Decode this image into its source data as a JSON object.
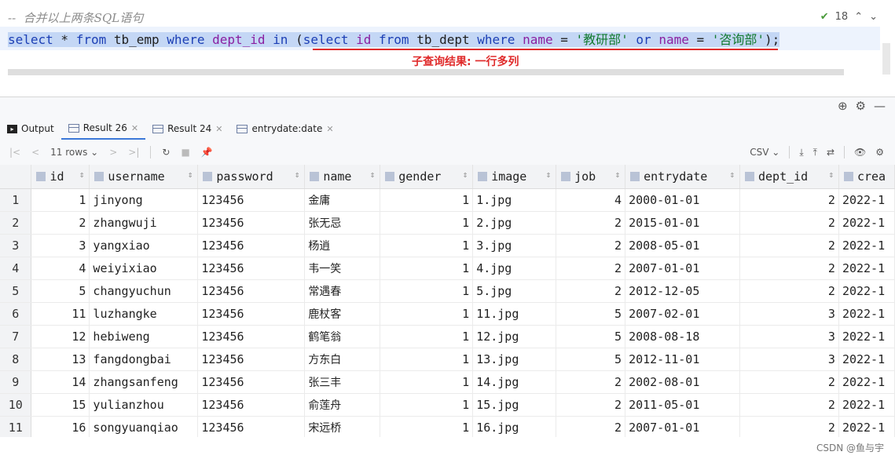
{
  "editor": {
    "comment": "--  合并以上两条SQL语句",
    "inspection_count": "18",
    "sql": {
      "p1": "select",
      "p2": " * ",
      "p3": "from",
      "p4": " tb_emp ",
      "p5": "where",
      "p6": " dept_id ",
      "p7": "in",
      "p8": " (",
      "p9": "select",
      "p10": " id ",
      "p11": "from",
      "p12": " tb_dept ",
      "p13": "where",
      "p14": " name ",
      "p15": "= ",
      "p16": "'教研部'",
      "p17": " or ",
      "p18": "name",
      "p19": " = ",
      "p20": "'咨询部'",
      "p21": ");"
    },
    "annotation": "子查询结果: 一行多列",
    "annotation_color": "#e02b2b"
  },
  "results": {
    "tabs": [
      {
        "label": "Output"
      },
      {
        "label": "Result 26"
      },
      {
        "label": "Result 24"
      },
      {
        "label": "entrydate:date"
      }
    ],
    "toolbar": {
      "rows_label": "11 rows",
      "export_format": "CSV"
    },
    "columns": [
      "id",
      "username",
      "password",
      "name",
      "gender",
      "image",
      "job",
      "entrydate",
      "dept_id",
      "crea"
    ],
    "rows": [
      {
        "n": "1",
        "id": "1",
        "username": "jinyong",
        "password": "123456",
        "name": "金庸",
        "gender": "1",
        "image": "1.jpg",
        "job": "4",
        "entrydate": "2000-01-01",
        "dept_id": "2",
        "crea": "2022-1"
      },
      {
        "n": "2",
        "id": "2",
        "username": "zhangwuji",
        "password": "123456",
        "name": "张无忌",
        "gender": "1",
        "image": "2.jpg",
        "job": "2",
        "entrydate": "2015-01-01",
        "dept_id": "2",
        "crea": "2022-1"
      },
      {
        "n": "3",
        "id": "3",
        "username": "yangxiao",
        "password": "123456",
        "name": "杨逍",
        "gender": "1",
        "image": "3.jpg",
        "job": "2",
        "entrydate": "2008-05-01",
        "dept_id": "2",
        "crea": "2022-1"
      },
      {
        "n": "4",
        "id": "4",
        "username": "weiyixiao",
        "password": "123456",
        "name": "韦一笑",
        "gender": "1",
        "image": "4.jpg",
        "job": "2",
        "entrydate": "2007-01-01",
        "dept_id": "2",
        "crea": "2022-1"
      },
      {
        "n": "5",
        "id": "5",
        "username": "changyuchun",
        "password": "123456",
        "name": "常遇春",
        "gender": "1",
        "image": "5.jpg",
        "job": "2",
        "entrydate": "2012-12-05",
        "dept_id": "2",
        "crea": "2022-1"
      },
      {
        "n": "6",
        "id": "11",
        "username": "luzhangke",
        "password": "123456",
        "name": "鹿杖客",
        "gender": "1",
        "image": "11.jpg",
        "job": "5",
        "entrydate": "2007-02-01",
        "dept_id": "3",
        "crea": "2022-1"
      },
      {
        "n": "7",
        "id": "12",
        "username": "hebiweng",
        "password": "123456",
        "name": "鹤笔翁",
        "gender": "1",
        "image": "12.jpg",
        "job": "5",
        "entrydate": "2008-08-18",
        "dept_id": "3",
        "crea": "2022-1"
      },
      {
        "n": "8",
        "id": "13",
        "username": "fangdongbai",
        "password": "123456",
        "name": "方东白",
        "gender": "1",
        "image": "13.jpg",
        "job": "5",
        "entrydate": "2012-11-01",
        "dept_id": "3",
        "crea": "2022-1"
      },
      {
        "n": "9",
        "id": "14",
        "username": "zhangsanfeng",
        "password": "123456",
        "name": "张三丰",
        "gender": "1",
        "image": "14.jpg",
        "job": "2",
        "entrydate": "2002-08-01",
        "dept_id": "2",
        "crea": "2022-1"
      },
      {
        "n": "10",
        "id": "15",
        "username": "yulianzhou",
        "password": "123456",
        "name": "俞莲舟",
        "gender": "1",
        "image": "15.jpg",
        "job": "2",
        "entrydate": "2011-05-01",
        "dept_id": "2",
        "crea": "2022-1"
      },
      {
        "n": "11",
        "id": "16",
        "username": "songyuanqiao",
        "password": "123456",
        "name": "宋远桥",
        "gender": "1",
        "image": "16.jpg",
        "job": "2",
        "entrydate": "2007-01-01",
        "dept_id": "2",
        "crea": "2022-1"
      }
    ]
  },
  "watermark": "CSDN @鱼与宇"
}
